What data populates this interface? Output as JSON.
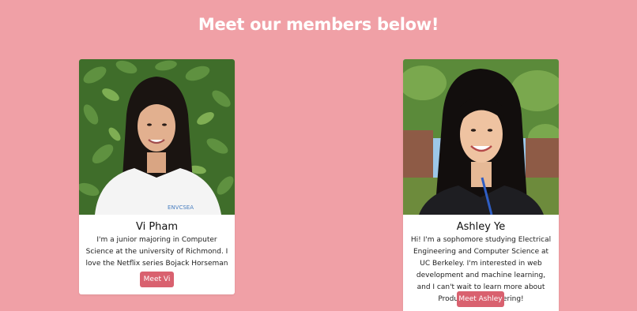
{
  "page": {
    "heading": "Meet our members below!",
    "background_color": "#f0a0a6",
    "button_color": "#d9616f"
  },
  "members": [
    {
      "name": "Vi Pham",
      "description": "I'm a junior majoring in Computer Science at the university of Richmond. I love the Netflix series Bojack Horseman :).",
      "button_label": "Meet Vi",
      "shirt_text": "ENVCSEA"
    },
    {
      "name": "Ashley Ye",
      "description": "Hi! I'm a sophomore studying Electrical Engineering and Computer Science at UC Berkeley. I'm interested in web development and machine learning, and I can't wait to learn more about Production Engineering!",
      "button_label": "Meet Ashley"
    }
  ]
}
